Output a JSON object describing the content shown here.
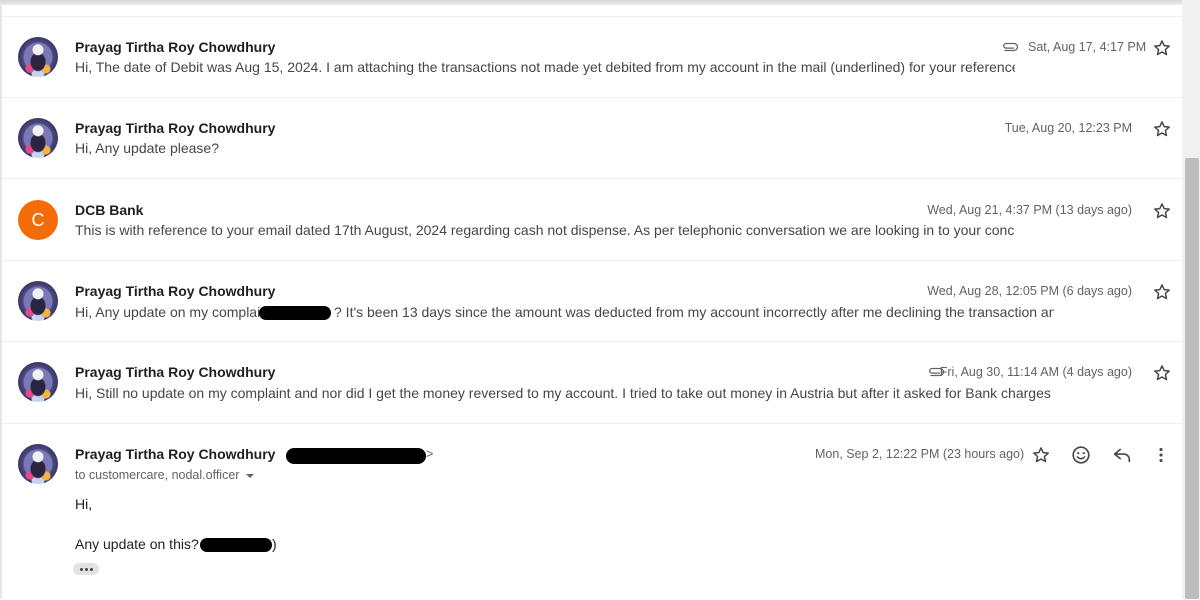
{
  "thread": {
    "messages": [
      {
        "sender": "Prayag Tirtha Roy Chowdhury",
        "date": "Sat, Aug 17, 4:17 PM",
        "snippet": "Hi, The date of Debit was Aug 15, 2024. I am attaching the transactions not made yet debited from my account in the mail (underlined) for your reference. The ma",
        "has_attachment": true
      },
      {
        "sender": "Prayag Tirtha Roy Chowdhury",
        "date": "Tue, Aug 20, 12:23 PM",
        "snippet": "Hi, Any update please?",
        "has_attachment": false
      },
      {
        "sender": "DCB Bank",
        "avatar_letter": "C",
        "avatar_color": "#F46B0A",
        "date": "Wed, Aug 21, 4:37 PM (13 days ago)",
        "snippet": "This is with reference to your email dated 17th August, 2024 regarding cash not dispense. As per telephonic conversation we are looking in to your concern and s",
        "has_attachment": false
      },
      {
        "sender": "Prayag Tirtha Roy Chowdhury",
        "date": "Wed, Aug 28, 12:05 PM (6 days ago)",
        "snippet_before": "Hi, Any update on my complaint",
        "snippet_after": "? It's been 13 days since the amount was deducted from my account incorrectly after me declining the transaction and yet",
        "has_attachment": false
      },
      {
        "sender": "Prayag Tirtha Roy Chowdhury",
        "date": "Fri, Aug 30, 11:14 AM (4 days ago)",
        "snippet": "Hi, Still no update on my complaint and nor did I get the money reversed to my account. I tried to take out money in Austria but after it asked for Bank charges",
        "has_attachment": true
      }
    ],
    "open_message": {
      "sender": "Prayag Tirtha Roy Chowdhury",
      "email_suffix": ">",
      "date": "Mon, Sep 2, 12:22 PM (23 hours ago)",
      "to": "to customercare, nodal.officer",
      "greeting": "Hi,",
      "body_before": "Any update on this? (",
      "body_after": ")"
    }
  },
  "icons": {
    "attachment": "paperclip-icon",
    "star": "star-outline-icon",
    "emoji": "emoji-react-icon",
    "reply": "reply-icon",
    "more": "more-vert-icon",
    "dropdown": "caret-down-icon",
    "trimmed": "show-trimmed-content-icon"
  },
  "colors": {
    "accent_avatar": "#F46B0A",
    "redaction": "#000000"
  }
}
